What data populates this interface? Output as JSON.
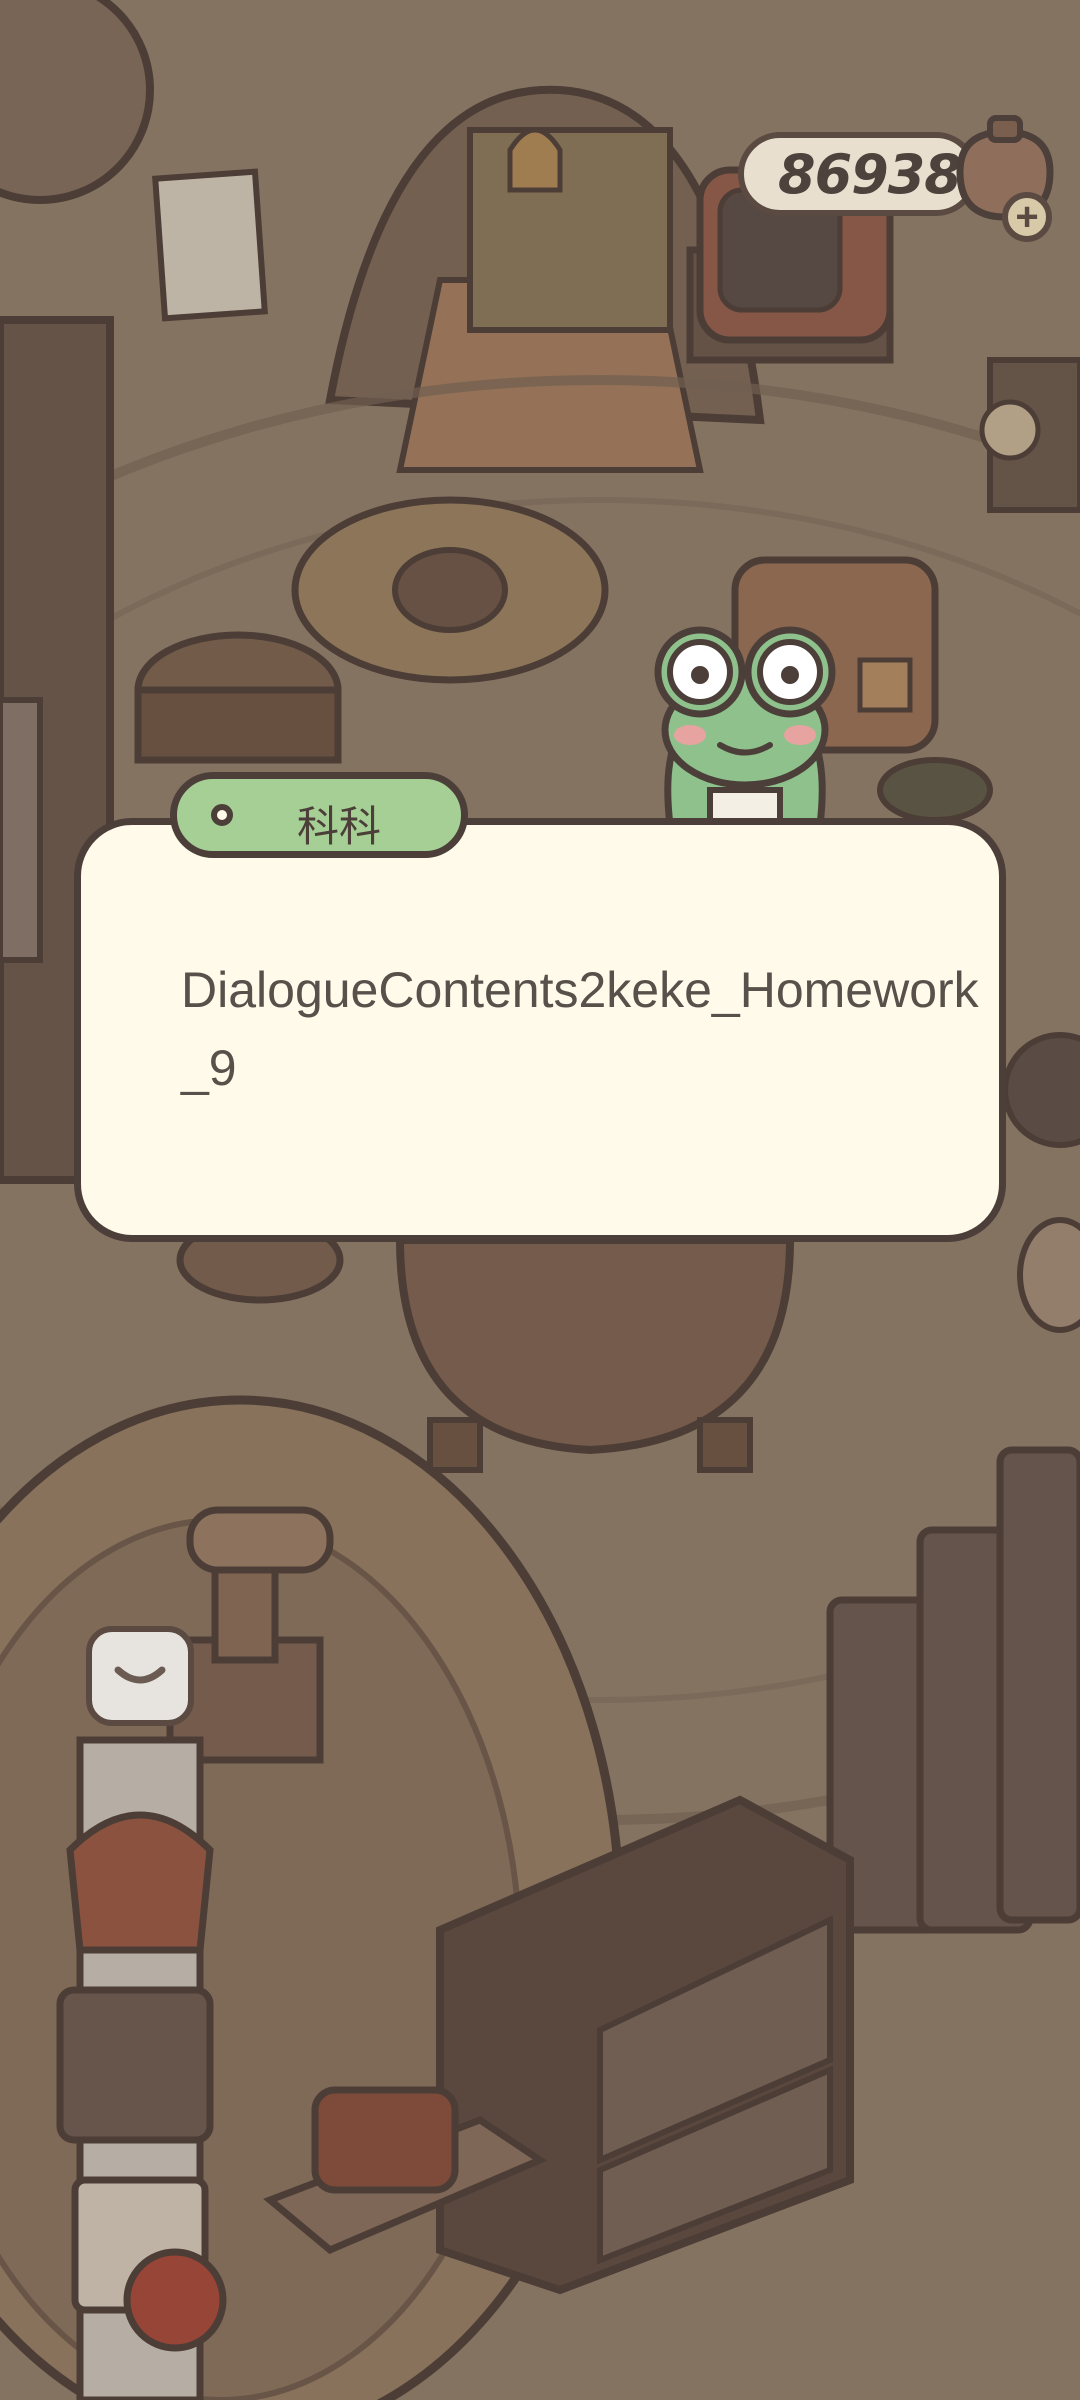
{
  "hud": {
    "coin_count": "86938",
    "coin_icon": "honey-pot-icon",
    "add_coins_icon": "plus-icon"
  },
  "dialogue": {
    "speaker_name": "科科",
    "text": "DialogueContents2keke_Homework_9",
    "colors": {
      "box_background": "#fffaea",
      "name_tag_background": "#a6cf95",
      "outline": "#4c3f3a"
    }
  },
  "scene": {
    "expand_icon": "chevron-down-icon",
    "character_icon": "frog-icon"
  }
}
